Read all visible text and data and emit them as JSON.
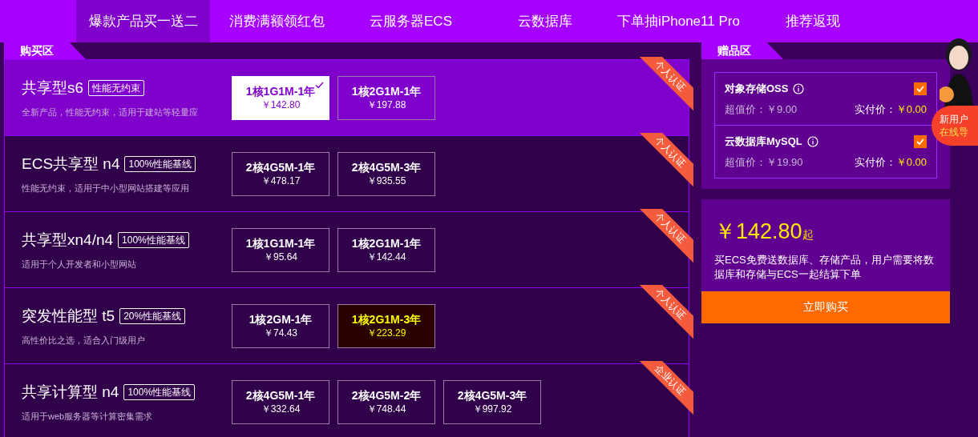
{
  "nav": [
    {
      "label": "爆款产品买一送二",
      "selected": true
    },
    {
      "label": "消费满额领红包",
      "selected": false
    },
    {
      "label": "云服务器ECS",
      "selected": false
    },
    {
      "label": "云数据库",
      "selected": false
    },
    {
      "label": "下单抽iPhone11 Pro",
      "selected": false
    },
    {
      "label": "推荐返现",
      "selected": false
    }
  ],
  "purchase": {
    "title": "购买区",
    "products": [
      {
        "name": "共享型s6",
        "badge": "性能无约束",
        "desc": "全新产品，性能无约束，适用于建站等轻量应",
        "ribbon": "个人认证",
        "selected": true,
        "options": [
          {
            "spec": "1核1G1M-1年",
            "price": "￥142.80",
            "selected": true,
            "highlighted": false
          },
          {
            "spec": "1核2G1M-1年",
            "price": "￥197.88",
            "selected": false,
            "highlighted": false
          }
        ]
      },
      {
        "name": "ECS共享型 n4",
        "badge": "100%性能基线",
        "desc": "性能无约束，适用于中小型网站搭建等应用",
        "ribbon": "个人认证",
        "selected": false,
        "options": [
          {
            "spec": "2核4G5M-1年",
            "price": "￥478.17",
            "selected": false,
            "highlighted": false
          },
          {
            "spec": "2核4G5M-3年",
            "price": "￥935.55",
            "selected": false,
            "highlighted": false
          }
        ]
      },
      {
        "name": "共享型xn4/n4",
        "badge": "100%性能基线",
        "desc": "适用于个人开发者和小型网站",
        "ribbon": "个人认证",
        "selected": false,
        "options": [
          {
            "spec": "1核1G1M-1年",
            "price": "￥95.64",
            "selected": false,
            "highlighted": false
          },
          {
            "spec": "1核2G1M-1年",
            "price": "￥142.44",
            "selected": false,
            "highlighted": false
          }
        ]
      },
      {
        "name": "突发性能型 t5",
        "badge": "20%性能基线",
        "desc": "高性价比之选，适合入门级用户",
        "ribbon": "个人认证",
        "selected": false,
        "options": [
          {
            "spec": "1核2GM-1年",
            "price": "￥74.43",
            "selected": false,
            "highlighted": false
          },
          {
            "spec": "1核2G1M-3年",
            "price": "￥223.29",
            "selected": false,
            "highlighted": true
          }
        ]
      },
      {
        "name": "共享计算型 n4",
        "badge": "100%性能基线",
        "desc": "适用于web服务器等计算密集需求",
        "ribbon": "企业认证",
        "selected": false,
        "options": [
          {
            "spec": "2核4G5M-1年",
            "price": "￥332.64",
            "selected": false,
            "highlighted": false
          },
          {
            "spec": "2核4G5M-2年",
            "price": "￥748.44",
            "selected": false,
            "highlighted": false
          },
          {
            "spec": "2核4G5M-3年",
            "price": "￥997.92",
            "selected": false,
            "highlighted": false
          }
        ]
      }
    ]
  },
  "gifts": {
    "title": "赠品区",
    "items": [
      {
        "name": "对象存储OSS",
        "value_label": "超值价：￥9.00",
        "pay_label": "实付价：",
        "pay_price": "￥0.00",
        "checked": true
      },
      {
        "name": "云数据库MySQL",
        "value_label": "超值价：￥19.90",
        "pay_label": "实付价：",
        "pay_price": "￥0.00",
        "checked": true
      }
    ]
  },
  "summary": {
    "price": "￥142.80",
    "suffix": "起",
    "note": "买ECS免费送数据库、存储产品，用户需要将数据库和存储与ECS一起结算下单",
    "button": "立即购买"
  },
  "helper": {
    "line1": "新用户",
    "line2": "在线导"
  }
}
